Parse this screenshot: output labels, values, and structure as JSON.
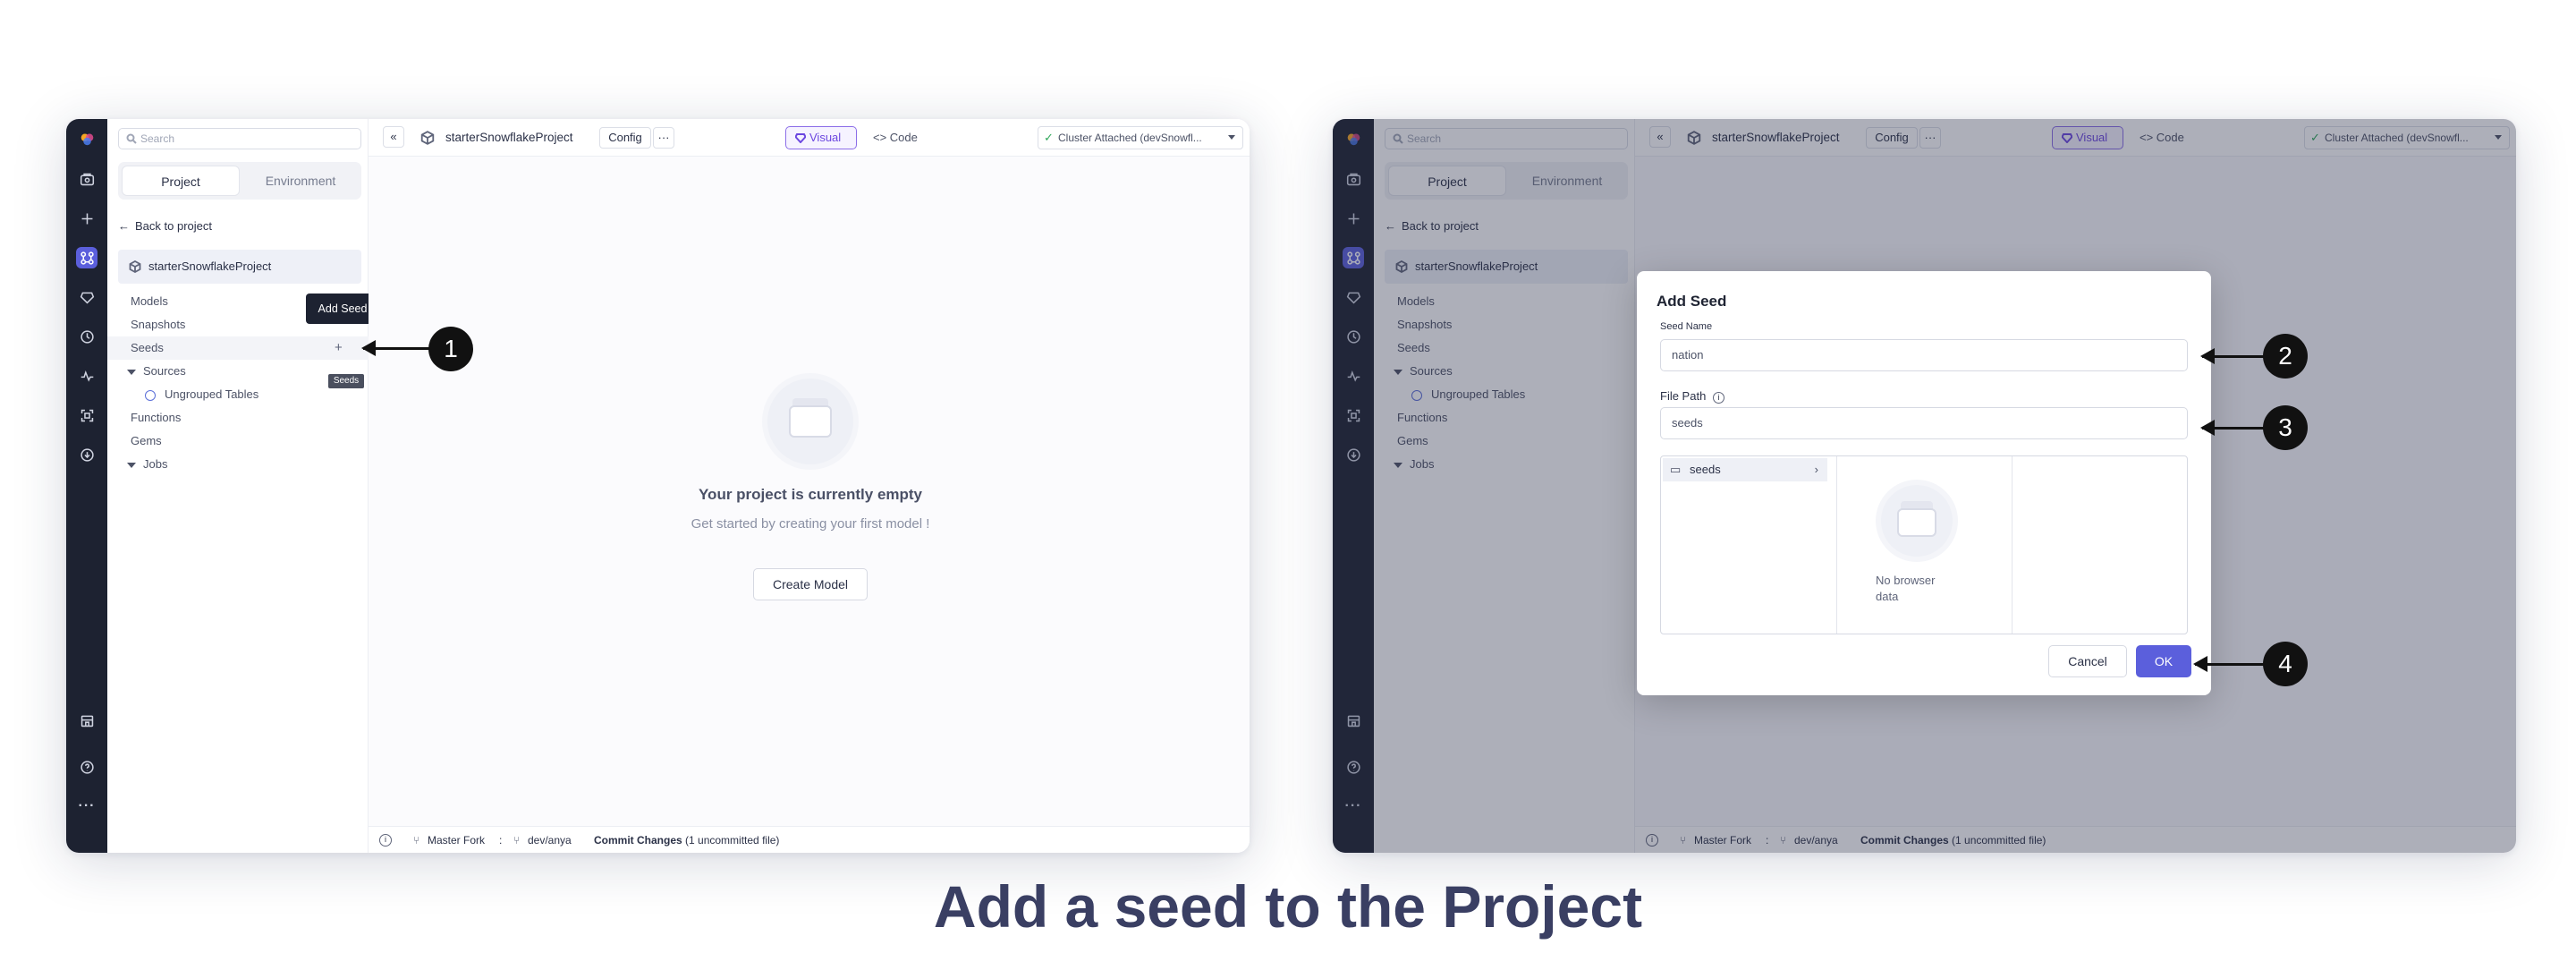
{
  "caption": "Add a seed to the Project",
  "colors": {
    "accent": "#5b5fdc",
    "visual_accent": "#6c47e0",
    "rail_bg": "#1d2231",
    "caption": "#3a3f63"
  },
  "rail_icons": [
    "logo-icon",
    "folder-icon",
    "plus-icon",
    "graph-icon",
    "gem-icon",
    "clock-icon",
    "activity-icon",
    "scan-icon",
    "download-icon",
    "store-icon",
    "help-icon",
    "more-icon"
  ],
  "sidebar": {
    "search_placeholder": "Search",
    "tab_project": "Project",
    "tab_environment": "Environment",
    "back_label": "Back to project",
    "project_name": "starterSnowflakeProject",
    "items": {
      "models": "Models",
      "snapshots": "Snapshots",
      "seeds": "Seeds",
      "sources": "Sources",
      "ungrouped": "Ungrouped Tables",
      "functions": "Functions",
      "gems": "Gems",
      "jobs": "Jobs"
    },
    "add_icon": "+"
  },
  "topbar": {
    "collapse": "«",
    "project_name": "starterSnowflakeProject",
    "config": "Config",
    "more": "···",
    "visual": "Visual",
    "code": "Code",
    "cluster": "Cluster Attached (devSnowfl..."
  },
  "empty": {
    "title": "Your project is currently empty",
    "subtitle": "Get started by creating your first model !",
    "button": "Create Model"
  },
  "tooltips": {
    "add_seed": "Add Seed",
    "seeds": "Seeds"
  },
  "statusbar": {
    "info": "i",
    "master_fork": "Master Fork",
    "sep": ":",
    "branch": "dev/anya",
    "commit": "Commit Changes",
    "uncommitted": "(1 uncommitted file)"
  },
  "modal": {
    "title": "Add Seed",
    "seed_name_label": "Seed Name",
    "seed_name_value": "nation",
    "file_path_label": "File Path",
    "file_path_value": "seeds",
    "folder": "seeds",
    "no_data": "No browser data",
    "cancel": "Cancel",
    "ok": "OK"
  },
  "markers": [
    "1",
    "2",
    "3",
    "4"
  ]
}
